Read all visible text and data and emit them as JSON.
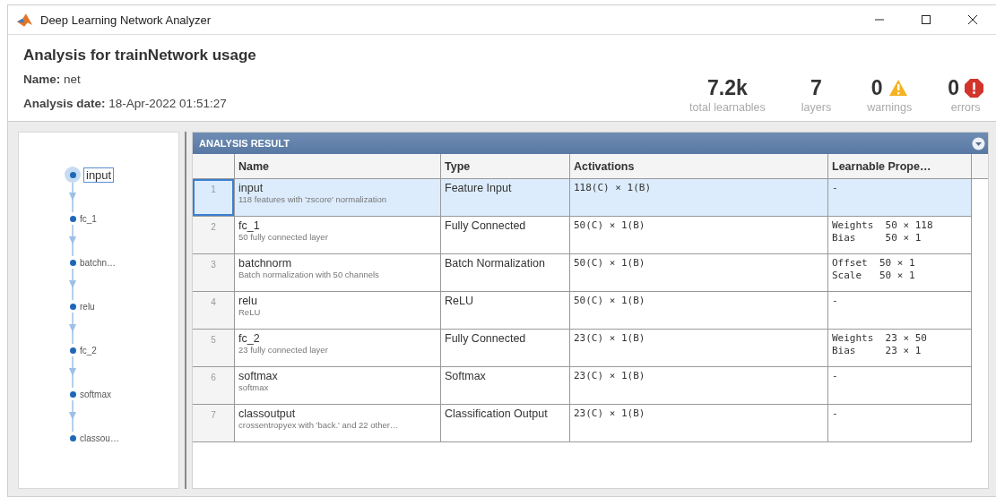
{
  "window": {
    "title": "Deep Learning Network Analyzer"
  },
  "header": {
    "title": "Analysis for trainNetwork usage",
    "name_label": "Name:",
    "name_value": "net",
    "date_label": "Analysis date:",
    "date_value": "18-Apr-2022 01:51:27"
  },
  "stats": [
    {
      "kind": "plain",
      "value": "7.2k",
      "label": "total learnables"
    },
    {
      "kind": "plain",
      "value": "7",
      "label": "layers"
    },
    {
      "kind": "warning",
      "value": "0",
      "label": "warnings"
    },
    {
      "kind": "error",
      "value": "0",
      "label": "errors"
    }
  ],
  "graph": {
    "nodes": [
      {
        "label": "input",
        "selected": true
      },
      {
        "label": "fc_1",
        "selected": false
      },
      {
        "label": "batchn…",
        "selected": false
      },
      {
        "label": "relu",
        "selected": false
      },
      {
        "label": "fc_2",
        "selected": false
      },
      {
        "label": "softmax",
        "selected": false
      },
      {
        "label": "classou…",
        "selected": false
      }
    ]
  },
  "table": {
    "title": "ANALYSIS RESULT",
    "columns": [
      "Name",
      "Type",
      "Activations",
      "Learnable Prope…"
    ],
    "rows": [
      {
        "index": "1",
        "name": "input",
        "description": "118 features with 'zscore' normalization",
        "type": "Feature Input",
        "activations": "118(C) × 1(B)",
        "learnables": [
          "-"
        ],
        "selected": true
      },
      {
        "index": "2",
        "name": "fc_1",
        "description": "50 fully connected layer",
        "type": "Fully Connected",
        "activations": "50(C) × 1(B)",
        "learnables": [
          "Weights  50 × 118",
          "Bias     50 × 1"
        ],
        "selected": false
      },
      {
        "index": "3",
        "name": "batchnorm",
        "description": "Batch normalization with 50 channels",
        "type": "Batch Normalization",
        "activations": "50(C) × 1(B)",
        "learnables": [
          "Offset  50 × 1",
          "Scale   50 × 1"
        ],
        "selected": false
      },
      {
        "index": "4",
        "name": "relu",
        "description": "ReLU",
        "type": "ReLU",
        "activations": "50(C) × 1(B)",
        "learnables": [
          "-"
        ],
        "selected": false
      },
      {
        "index": "5",
        "name": "fc_2",
        "description": "23 fully connected layer",
        "type": "Fully Connected",
        "activations": "23(C) × 1(B)",
        "learnables": [
          "Weights  23 × 50",
          "Bias     23 × 1"
        ],
        "selected": false
      },
      {
        "index": "6",
        "name": "softmax",
        "description": "softmax",
        "type": "Softmax",
        "activations": "23(C) × 1(B)",
        "learnables": [
          "-"
        ],
        "selected": false
      },
      {
        "index": "7",
        "name": "classoutput",
        "description": "crossentropyex with 'back.' and 22 other…",
        "type": "Classification Output",
        "activations": "23(C) × 1(B)",
        "learnables": [
          "-"
        ],
        "selected": false
      }
    ]
  }
}
